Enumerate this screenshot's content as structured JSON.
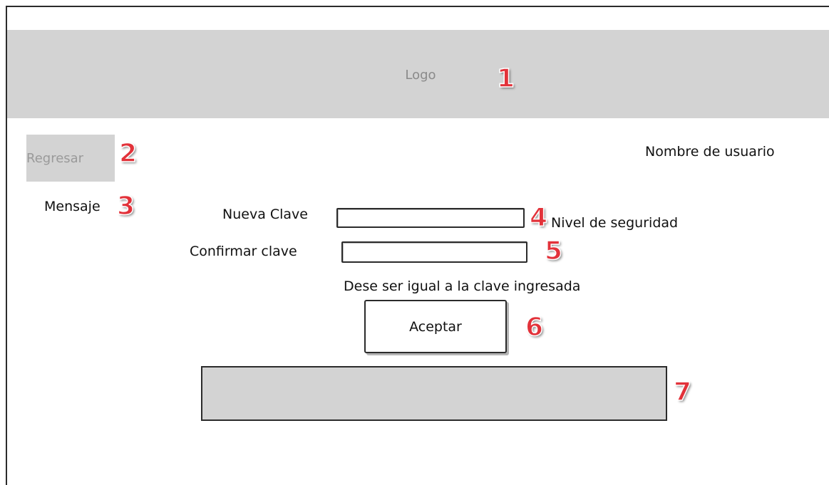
{
  "header": {
    "logo_text": "Logo"
  },
  "nav": {
    "back_label": "Regresar"
  },
  "user": {
    "name_label": "Nombre de usuario"
  },
  "message": {
    "label": "Mensaje"
  },
  "form": {
    "new_password_label": "Nueva Clave",
    "new_password_value": "",
    "confirm_password_label": "Confirmar clave",
    "confirm_password_value": "",
    "security_level_label": "Nivel de seguridad",
    "confirm_hint": "Dese ser igual a la clave ingresada",
    "accept_label": "Aceptar"
  },
  "markers": [
    "1",
    "2",
    "3",
    "4",
    "5",
    "6",
    "7"
  ],
  "colors": {
    "placeholder_gray": "#d3d3d3",
    "marker_red": "#e2323a",
    "border": "#2b2b2b"
  }
}
